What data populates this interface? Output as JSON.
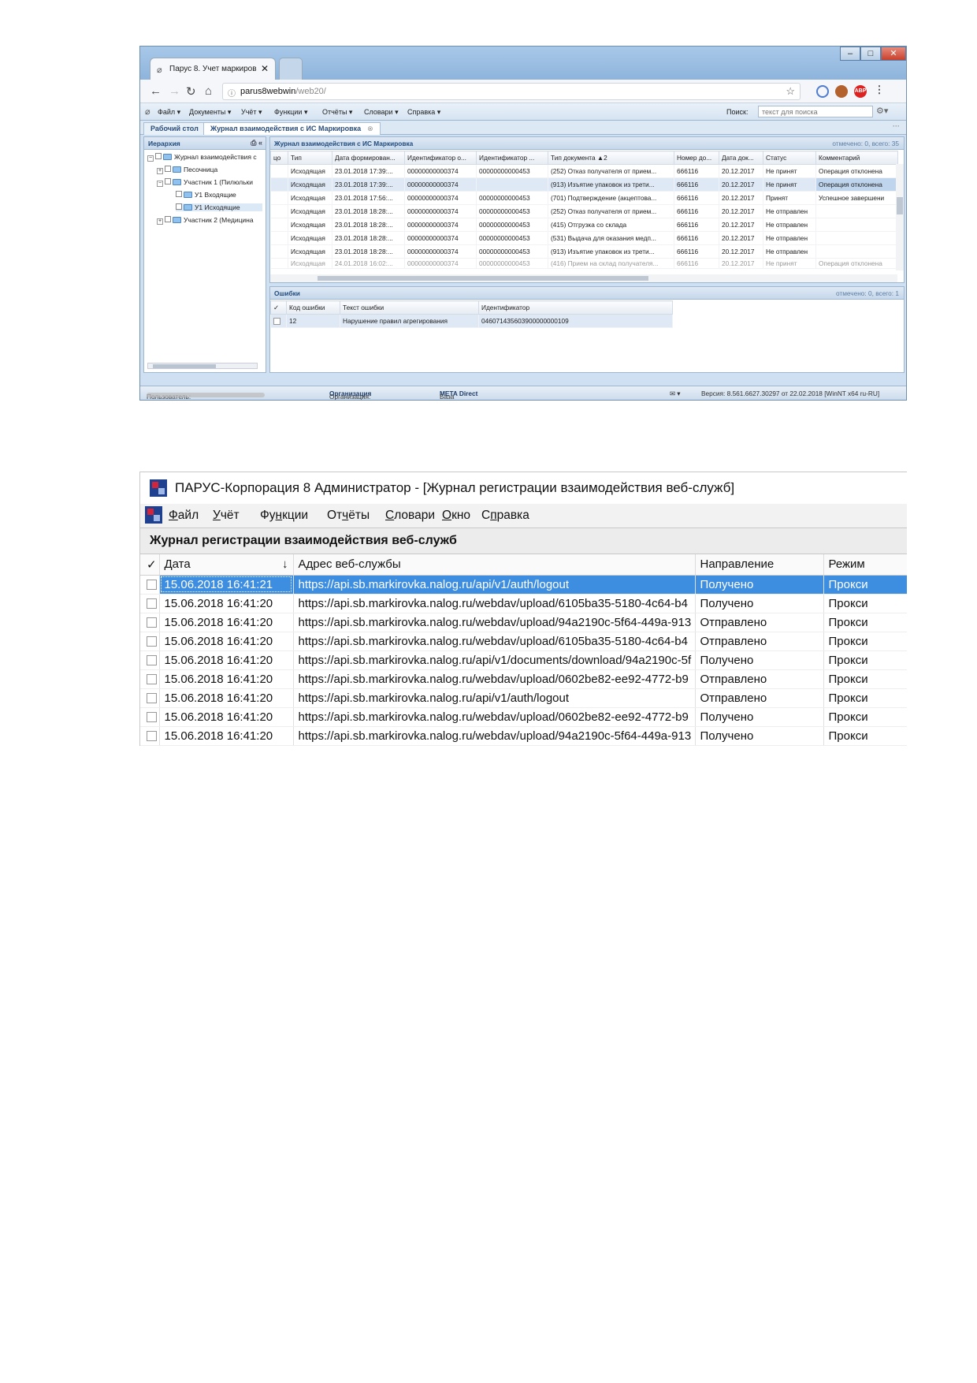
{
  "browser": {
    "tab_title": "Парус 8. Учет маркиров",
    "tab_close": "✕",
    "url_host": "parus8webwin",
    "url_path": "/web20/",
    "app_menu": [
      "Файл ▾",
      "Документы ▾",
      "Учёт ▾",
      "Функции ▾",
      "Отчёты ▾",
      "Словари ▾",
      "Справка ▾"
    ],
    "search_label": "Поиск:",
    "search_placeholder": "текст для поиска",
    "tabs": {
      "desktop": "Рабочий стол",
      "journal": "Журнал взаимодействия с ИС Маркировка",
      "more": "···"
    },
    "tree": {
      "header": "Иерархия",
      "items": [
        "Журнал взаимодействия с",
        "Песочница",
        "Участник 1 (Пилюльки",
        "У1 Входящие",
        "У1 Исходящие",
        "Участник 2 (Медицина"
      ]
    },
    "grid": {
      "header": "Журнал взаимодействия с ИС Маркировка",
      "count": "отмечено: 0, всего: 35",
      "columns": [
        "цо",
        "Тип",
        "Дата формирован...",
        "Идентификатор о...",
        "Идентификатор ...",
        "Тип документа ▲2",
        "Номер до...",
        "Дата док...",
        "Статус",
        "Комментарий"
      ],
      "rows": [
        [
          "",
          "Исходящая",
          "23.01.2018 17:39:...",
          "00000000000374",
          "00000000000453",
          "(252) Отказ получателя от прием...",
          "666116",
          "20.12.2017",
          "Не принят",
          "Операция отклонена"
        ],
        [
          "",
          "Исходящая",
          "23.01.2018 17:39:...",
          "00000000000374",
          "",
          "(913) Изъятие упаковок из трети...",
          "666116",
          "20.12.2017",
          "Не принят",
          "Операция отклонена"
        ],
        [
          "",
          "Исходящая",
          "23.01.2018 17:56:...",
          "00000000000374",
          "00000000000453",
          "(701) Подтверждение (акцептова...",
          "666116",
          "20.12.2017",
          "Принят",
          "Успешное завершени"
        ],
        [
          "",
          "Исходящая",
          "23.01.2018 18:28:...",
          "00000000000374",
          "00000000000453",
          "(252) Отказ получателя от прием...",
          "666116",
          "20.12.2017",
          "Не отправлен",
          ""
        ],
        [
          "",
          "Исходящая",
          "23.01.2018 18:28:...",
          "00000000000374",
          "00000000000453",
          "(415) Отгрузка со склада",
          "666116",
          "20.12.2017",
          "Не отправлен",
          ""
        ],
        [
          "",
          "Исходящая",
          "23.01.2018 18:28:...",
          "00000000000374",
          "00000000000453",
          "(531) Выдача для оказания медп...",
          "666116",
          "20.12.2017",
          "Не отправлен",
          ""
        ],
        [
          "",
          "Исходящая",
          "23.01.2018 18:28:...",
          "00000000000374",
          "00000000000453",
          "(913) Изъятие упаковок из трети...",
          "666116",
          "20.12.2017",
          "Не отправлен",
          ""
        ],
        [
          "",
          "Исходящая",
          "24.01.2018 16:02:...",
          "00000000000374",
          "00000000000453",
          "(416) Прием на склад получателя...",
          "666116",
          "20.12.2017",
          "Не принят",
          "Операция отклонена"
        ]
      ]
    },
    "errors": {
      "header": "Ошибки",
      "count": "отмечено: 0, всего: 1",
      "columns": [
        "✓",
        "Код ошибки",
        "Текст ошибки",
        "Идентификатор"
      ],
      "rows": [
        [
          "",
          "12",
          "Нарушение правил агрегирования",
          "046071435603900000000109"
        ]
      ]
    },
    "status": {
      "user_label": "Пользователь:",
      "org_label": "Организация:",
      "org_value": "Организация",
      "db_label": "База данных:",
      "db_value": "META Direct",
      "version": "Версия: 8.561.6627.30297 от 22.02.2018 [WinNT x64 ru-RU]"
    }
  },
  "desktop": {
    "window_title": "ПАРУС-Корпорация 8 Администратор - [Журнал регистрации взаимодействия веб-служб]",
    "menu": [
      {
        "u": "Ф",
        "rest": "айл"
      },
      {
        "u": "У",
        "rest": "чёт"
      },
      {
        "pre": "Фу",
        "u": "н",
        "rest": "кции"
      },
      {
        "pre": "От",
        "u": "ч",
        "rest": "ёты"
      },
      {
        "u": "С",
        "rest": "ловари"
      },
      {
        "u": "О",
        "rest": "кно"
      },
      {
        "pre": "С",
        "u": "п",
        "rest": "равка"
      }
    ],
    "journal_title": "Журнал регистрации взаимодействия веб-служб",
    "columns": [
      "✓",
      "Дата",
      "↓",
      "Адрес веб-службы",
      "Направление",
      "Режим"
    ],
    "rows": [
      [
        "15.06.2018 16:41:21",
        "https://api.sb.markirovka.nalog.ru/api/v1/auth/logout",
        "Получено",
        "Прокси"
      ],
      [
        "15.06.2018 16:41:20",
        "https://api.sb.markirovka.nalog.ru/webdav/upload/6105ba35-5180-4c64-b4",
        "Получено",
        "Прокси"
      ],
      [
        "15.06.2018 16:41:20",
        "https://api.sb.markirovka.nalog.ru/webdav/upload/94a2190c-5f64-449a-913",
        "Отправлено",
        "Прокси"
      ],
      [
        "15.06.2018 16:41:20",
        "https://api.sb.markirovka.nalog.ru/webdav/upload/6105ba35-5180-4c64-b4",
        "Отправлено",
        "Прокси"
      ],
      [
        "15.06.2018 16:41:20",
        "https://api.sb.markirovka.nalog.ru/api/v1/documents/download/94a2190c-5f",
        "Получено",
        "Прокси"
      ],
      [
        "15.06.2018 16:41:20",
        "https://api.sb.markirovka.nalog.ru/webdav/upload/0602be82-ee92-4772-b9",
        "Отправлено",
        "Прокси"
      ],
      [
        "15.06.2018 16:41:20",
        "https://api.sb.markirovka.nalog.ru/api/v1/auth/logout",
        "Отправлено",
        "Прокси"
      ],
      [
        "15.06.2018 16:41:20",
        "https://api.sb.markirovka.nalog.ru/webdav/upload/0602be82-ee92-4772-b9",
        "Получено",
        "Прокси"
      ],
      [
        "15.06.2018 16:41:20",
        "https://api.sb.markirovka.nalog.ru/webdav/upload/94a2190c-5f64-449a-913",
        "Получено",
        "Прокси"
      ]
    ]
  }
}
